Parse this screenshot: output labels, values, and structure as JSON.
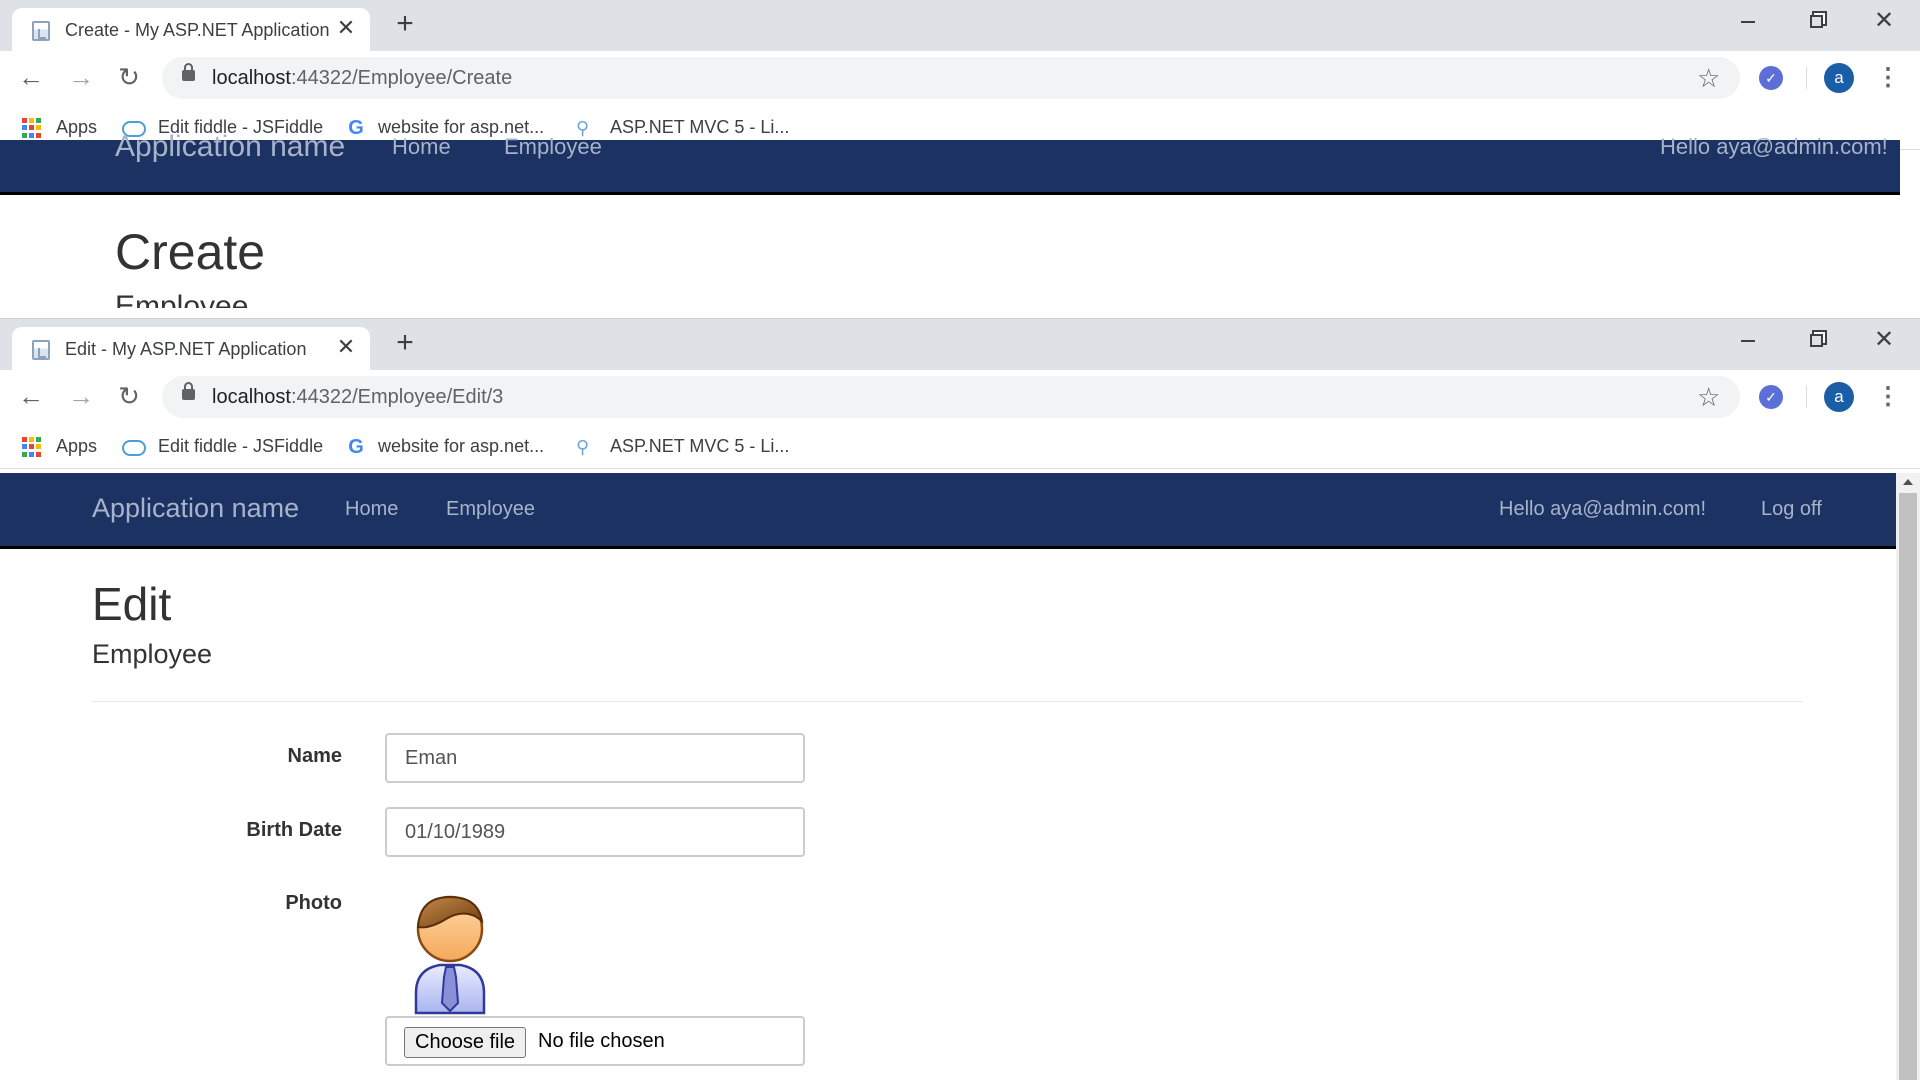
{
  "back_window": {
    "tab_title": "Create - My ASP.NET Application",
    "url_host": "localhost",
    "url_path": ":44322/Employee/Create",
    "brand": "Application name",
    "nav_home": "Home",
    "nav_employee": "Employee",
    "greeting": "Hello aya@admin.com!",
    "page_title": "Create",
    "page_subtitle": "Employee"
  },
  "front_window": {
    "tab_title": "Edit - My ASP.NET Application",
    "url_host": "localhost",
    "url_path": ":44322/Employee/Edit/3",
    "brand": "Application name",
    "nav_home": "Home",
    "nav_employee": "Employee",
    "greeting": "Hello aya@admin.com!",
    "logoff": "Log off",
    "page_title": "Edit",
    "page_subtitle": "Employee",
    "form": {
      "name_label": "Name",
      "name_value": "Eman",
      "birthdate_label": "Birth Date",
      "birthdate_value": "01/10/1989",
      "photo_label": "Photo",
      "file_button": "Choose file",
      "file_status": "No file chosen"
    }
  },
  "browser": {
    "new_tab": "+",
    "close_tab": "✕",
    "avatar_letter": "a",
    "bookmarks": [
      "Apps",
      "Edit fiddle - JSFiddle",
      "website for asp.net...",
      "ASP.NET MVC 5 - Li..."
    ]
  },
  "colors": {
    "navbar_bg": "#1b3263",
    "nav_text": "#a7b3c9",
    "tabstrip_bg": "#dee1e6"
  },
  "icons": [
    "back-arrow-icon",
    "forward-arrow-icon",
    "reload-icon",
    "lock-icon",
    "star-icon",
    "extension-check-icon",
    "kebab-menu-icon",
    "apps-grid-icon",
    "jsfiddle-cloud-icon",
    "google-icon",
    "mvc-icon",
    "page-favicon-icon",
    "user-avatar-image"
  ]
}
